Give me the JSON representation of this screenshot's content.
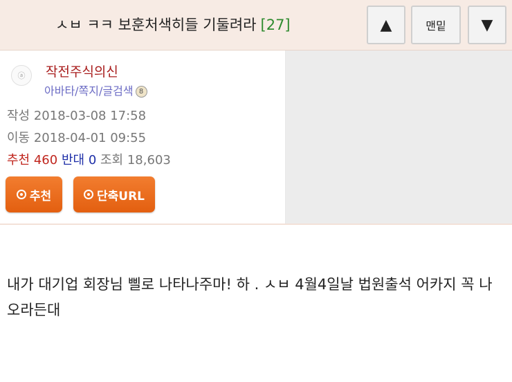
{
  "header": {
    "title": "ㅅㅂ ㅋㅋ 보훈처색히들 기둘려라",
    "comment_count": "[27]",
    "up_label": "▲",
    "bottom_label": "맨밑",
    "down_label": "▼"
  },
  "author": {
    "avatar_text": "ⓐ",
    "nickname": "작전주식의신",
    "links": "아바타/쪽지/글검색",
    "level_badge": "8"
  },
  "meta": {
    "written_label": "작성",
    "written": "2018-03-08 17:58",
    "moved_label": "이동",
    "moved": "2018-04-01 09:55",
    "recommend_label": "추천",
    "recommend": "460",
    "oppose_label": "반대",
    "oppose": "0",
    "views_label": "조회",
    "views": "18,603"
  },
  "buttons": {
    "recommend": "추천",
    "short_url": "단축URL"
  },
  "post": {
    "body": "내가 대기업 회장님 삘로 나타나주마! 하 . ㅅㅂ 4월4일날 법원출석 어카지 꼭 나오라든대"
  },
  "colors": {
    "header_bg": "#f7ebe4",
    "nickname": "#a81c1c",
    "recommend": "#c0261e",
    "oppose": "#1e2fa8",
    "orange_button": "#eb6a1c"
  }
}
